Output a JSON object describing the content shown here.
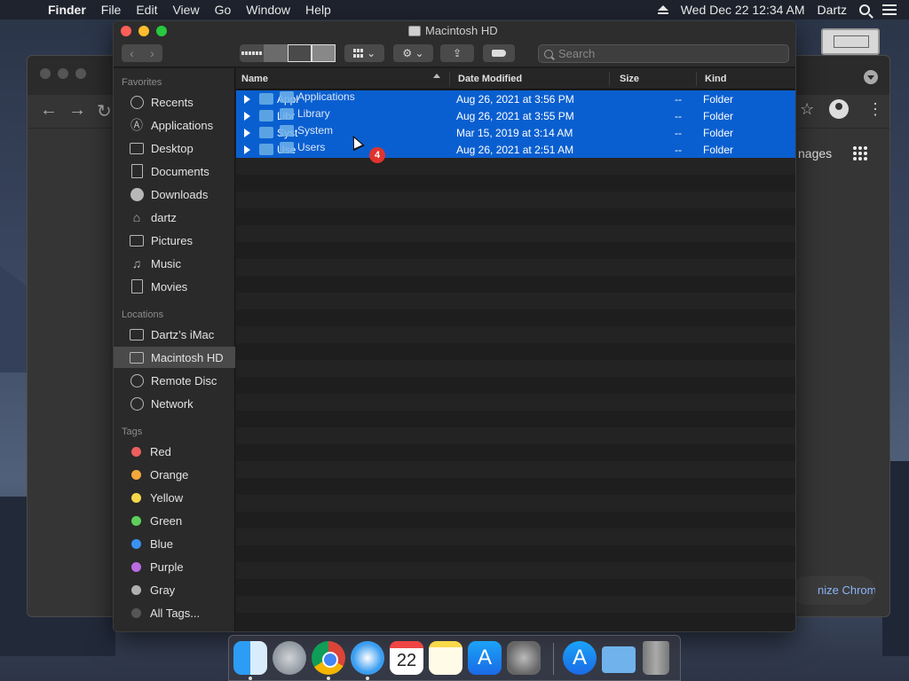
{
  "menubar": {
    "app_name": "Finder",
    "menus": [
      "File",
      "Edit",
      "View",
      "Go",
      "Window",
      "Help"
    ],
    "datetime": "Wed Dec 22  12:34 AM",
    "user": "Dartz"
  },
  "chrome": {
    "images_link": "nages",
    "customize_button": "nize Chrome"
  },
  "finder": {
    "title": "Macintosh HD",
    "search_placeholder": "Search",
    "sidebar": {
      "favorites_heading": "Favorites",
      "favorites": [
        "Recents",
        "Applications",
        "Desktop",
        "Documents",
        "Downloads",
        "dartz",
        "Pictures",
        "Music",
        "Movies"
      ],
      "locations_heading": "Locations",
      "locations": [
        "Dartz’s iMac",
        "Macintosh HD",
        "Remote Disc",
        "Network"
      ],
      "tags_heading": "Tags",
      "tags": [
        {
          "label": "Red",
          "color": "#ec5f5e"
        },
        {
          "label": "Orange",
          "color": "#f4a83a"
        },
        {
          "label": "Yellow",
          "color": "#f6d74a"
        },
        {
          "label": "Green",
          "color": "#5ed05a"
        },
        {
          "label": "Blue",
          "color": "#3a8ff1"
        },
        {
          "label": "Purple",
          "color": "#bb6ce3"
        },
        {
          "label": "Gray",
          "color": "#b0b0b0"
        },
        {
          "label": "All Tags...",
          "color": "#555555"
        }
      ]
    },
    "columns": {
      "name": "Name",
      "date": "Date Modified",
      "size": "Size",
      "kind": "Kind"
    },
    "rows": [
      {
        "name": "Appl",
        "date": "Aug 26, 2021 at 3:56 PM",
        "size": "--",
        "kind": "Folder"
      },
      {
        "name": "Libr",
        "date": "Aug 26, 2021 at 3:55 PM",
        "size": "--",
        "kind": "Folder"
      },
      {
        "name": "Syst",
        "date": "Mar 15, 2019 at 3:14 AM",
        "size": "--",
        "kind": "Folder"
      },
      {
        "name": "Use",
        "date": "Aug 26, 2021 at 2:51 AM",
        "size": "--",
        "kind": "Folder"
      }
    ],
    "drag_items": [
      "Applications",
      "Library",
      "System",
      "Users"
    ],
    "drag_count": "4"
  },
  "dock": {
    "calendar_day": "22",
    "calendar_month": "DEC"
  }
}
